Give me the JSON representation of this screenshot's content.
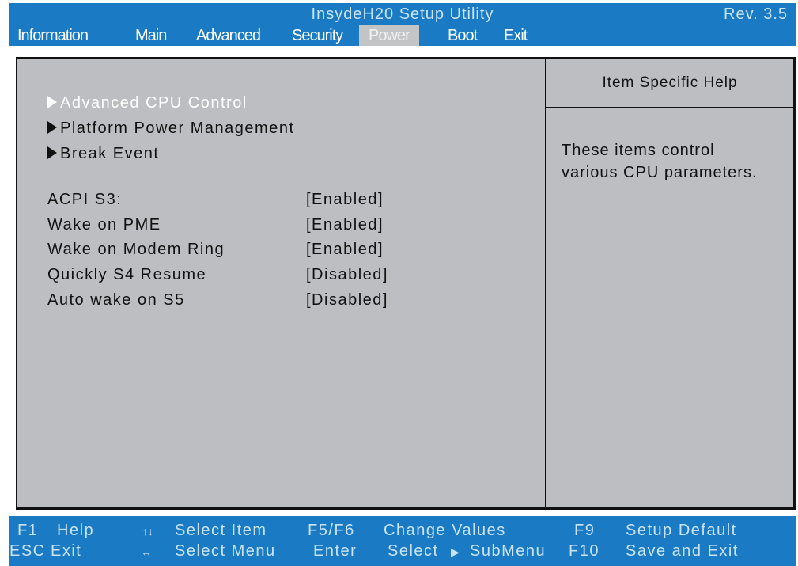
{
  "title": "InsydeH20 Setup Utility",
  "revision": "Rev. 3.5",
  "menu": {
    "items": [
      {
        "label": "Information"
      },
      {
        "label": "Main"
      },
      {
        "label": "Advanced"
      },
      {
        "label": "Security"
      },
      {
        "label": "Power",
        "active": true
      },
      {
        "label": "Boot"
      },
      {
        "label": "Exit"
      }
    ]
  },
  "submenus": [
    {
      "label": "Advanced CPU Control",
      "selected": true
    },
    {
      "label": "Platform Power Management"
    },
    {
      "label": "Break Event"
    }
  ],
  "settings": [
    {
      "label": "ACPI S3:",
      "value": "[Enabled]"
    },
    {
      "label": "Wake on PME",
      "value": "[Enabled]"
    },
    {
      "label": "Wake on Modem Ring",
      "value": "[Enabled]"
    },
    {
      "label": "Quickly S4 Resume",
      "value": "[Disabled]"
    },
    {
      "label": "Auto wake on S5",
      "value": "[Disabled]"
    }
  ],
  "help": {
    "title": "Item Specific Help",
    "lines": [
      "These items control",
      "various CPU parameters."
    ]
  },
  "footer": {
    "f1_key": "F1",
    "f1_label": "Help",
    "esc_key": "ESC",
    "esc_label": "Exit",
    "updown_icon": "↑↓",
    "updown_label": "Select Item",
    "leftright_icon": "↔",
    "leftright_label": "Select Menu",
    "f5f6_key": "F5/F6",
    "f5f6_label": "Change Values",
    "enter_key": "Enter",
    "enter_label_pre": "Select",
    "enter_label_post": "SubMenu",
    "f9_key": "F9",
    "f9_label": "Setup Default",
    "f10_key": "F10",
    "f10_label": "Save and Exit"
  },
  "colors": {
    "bar": "#1a7ac4",
    "bar_text": "#c9e3f2",
    "panel": "#bdbec1",
    "active_tab": "#c3c4c6"
  }
}
